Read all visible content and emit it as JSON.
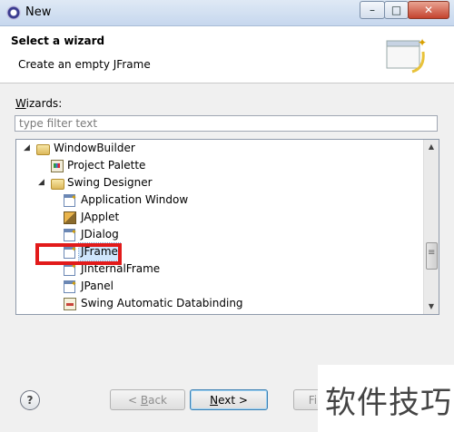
{
  "window": {
    "title": "New",
    "min_symbol": "–",
    "max_symbol": "□",
    "close_symbol": "✕"
  },
  "header": {
    "title": "Select a wizard",
    "description": "Create an empty JFrame"
  },
  "wizards": {
    "label_underlined": "W",
    "label_rest": "izards:",
    "filter_placeholder": "type filter text"
  },
  "tree": {
    "items": [
      {
        "label": "WindowBuilder",
        "icon": "folder-icon",
        "expanded": true
      },
      {
        "label": "Project Palette",
        "icon": "palette-icon"
      },
      {
        "label": "Swing Designer",
        "icon": "folder-icon",
        "expanded": true
      },
      {
        "label": "Application Window",
        "icon": "frame-icon"
      },
      {
        "label": "JApplet",
        "icon": "applet-icon"
      },
      {
        "label": "JDialog",
        "icon": "frame-icon"
      },
      {
        "label": "JFrame",
        "icon": "frame-icon",
        "selected": true
      },
      {
        "label": "JInternalFrame",
        "icon": "frame-icon"
      },
      {
        "label": "JPanel",
        "icon": "frame-icon"
      },
      {
        "label": "Swing Automatic Databinding",
        "icon": "databinding-icon"
      }
    ]
  },
  "buttons": {
    "help": "?",
    "back_prefix": "< ",
    "back_underlined": "B",
    "back_rest": "ack",
    "next_underlined": "N",
    "next_rest": "ext >",
    "finish": "Finis"
  },
  "watermark": "软件技巧",
  "colors": {
    "highlight": "#e21a1a",
    "selection": "#cfe6fc"
  }
}
